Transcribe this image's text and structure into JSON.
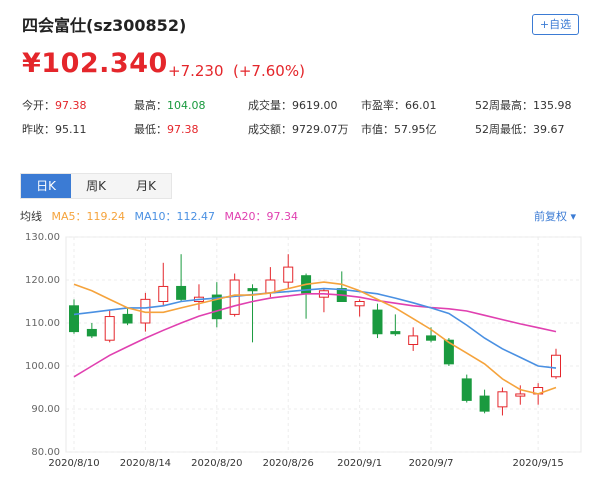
{
  "header": {
    "title": "四会富仕(sz300852)",
    "watch_button": "+自选"
  },
  "quote": {
    "price": "¥102.340",
    "change": "+7.230",
    "change_pct": "(+7.60%)"
  },
  "stats": {
    "open_label": "今开：",
    "open": "97.38",
    "high_label": "最高：",
    "high": "104.08",
    "volume_label": "成交量：",
    "volume": "9619.00",
    "pe_label": "市盈率：",
    "pe": "66.01",
    "w52high_label": "52周最高：",
    "w52high": "135.98",
    "prev_label": "昨收：",
    "prev": "95.11",
    "low_label": "最低：",
    "low": "97.38",
    "amount_label": "成交额：",
    "amount": "9729.07万",
    "mcap_label": "市值：",
    "mcap": "57.95亿",
    "w52low_label": "52周最低：",
    "w52low": "39.67"
  },
  "tabs": [
    "日K",
    "周K",
    "月K"
  ],
  "ma_legend": {
    "label": "均线",
    "ma5": "MA5：119.24",
    "ma10": "MA10：112.47",
    "ma20": "MA20：97.34",
    "adjust": "前复权 ▾"
  },
  "colors": {
    "up": "#e4262b",
    "down": "#1a9a3f",
    "ma5": "#f5a33c",
    "ma10": "#4a90e2",
    "ma20": "#e040b0",
    "accent": "#3b7bd4"
  },
  "chart_data": {
    "type": "candlestick",
    "ylim": [
      80,
      130
    ],
    "yticks": [
      "130.00",
      "120.00",
      "110.00",
      "100.00",
      "90.00",
      "80.00"
    ],
    "xticks": [
      "2020/8/10",
      "2020/8/14",
      "2020/8/20",
      "2020/8/26",
      "2020/9/1",
      "2020/9/7",
      "2020/9/15"
    ],
    "xtick_index": [
      0,
      4,
      8,
      12,
      16,
      20,
      26
    ],
    "candles": [
      {
        "o": 114,
        "h": 115.5,
        "l": 107.5,
        "c": 108
      },
      {
        "o": 108.5,
        "h": 110,
        "l": 106.5,
        "c": 107
      },
      {
        "o": 106,
        "h": 113,
        "l": 105.5,
        "c": 111.5
      },
      {
        "o": 112,
        "h": 113.5,
        "l": 109.5,
        "c": 110
      },
      {
        "o": 110,
        "h": 117,
        "l": 108,
        "c": 115.5
      },
      {
        "o": 115,
        "h": 124,
        "l": 114,
        "c": 118.5
      },
      {
        "o": 118.5,
        "h": 126,
        "l": 115,
        "c": 115.5
      },
      {
        "o": 115,
        "h": 119,
        "l": 113,
        "c": 116
      },
      {
        "o": 116.5,
        "h": 119.5,
        "l": 109,
        "c": 111
      },
      {
        "o": 112,
        "h": 121.5,
        "l": 111.5,
        "c": 120
      },
      {
        "o": 118,
        "h": 119,
        "l": 105.5,
        "c": 117.5
      },
      {
        "o": 117,
        "h": 123,
        "l": 116,
        "c": 120
      },
      {
        "o": 119.5,
        "h": 126,
        "l": 118,
        "c": 123
      },
      {
        "o": 121,
        "h": 121.5,
        "l": 111,
        "c": 117
      },
      {
        "o": 116,
        "h": 118,
        "l": 112.5,
        "c": 117.5
      },
      {
        "o": 118,
        "h": 122,
        "l": 116,
        "c": 115
      },
      {
        "o": 114,
        "h": 115.5,
        "l": 111.5,
        "c": 115
      },
      {
        "o": 113,
        "h": 114.5,
        "l": 106.5,
        "c": 107.5
      },
      {
        "o": 108,
        "h": 112,
        "l": 107,
        "c": 107.5
      },
      {
        "o": 105,
        "h": 109,
        "l": 103.5,
        "c": 107
      },
      {
        "o": 107,
        "h": 109,
        "l": 105.5,
        "c": 106
      },
      {
        "o": 106,
        "h": 106.5,
        "l": 100,
        "c": 100.5
      },
      {
        "o": 97,
        "h": 98,
        "l": 91.5,
        "c": 92
      },
      {
        "o": 93,
        "h": 94.5,
        "l": 89,
        "c": 89.5
      },
      {
        "o": 90.5,
        "h": 95,
        "l": 88.5,
        "c": 94
      },
      {
        "o": 93,
        "h": 95.5,
        "l": 91,
        "c": 93.5
      },
      {
        "o": 93.5,
        "h": 96,
        "l": 91,
        "c": 95
      },
      {
        "o": 97.5,
        "h": 104,
        "l": 97,
        "c": 102.5
      }
    ],
    "ma5": [
      119,
      117.5,
      115.5,
      113.5,
      112.5,
      112.5,
      113.5,
      114.5,
      115.5,
      116.5,
      116.5,
      117,
      118,
      119,
      119.5,
      119,
      117.5,
      115.5,
      113.5,
      111,
      108.5,
      105.5,
      103,
      100.5,
      97,
      94.5,
      93.5,
      95
    ],
    "ma10": [
      112,
      112.5,
      113,
      113.5,
      113.5,
      114,
      115,
      115.5,
      115.8,
      116.2,
      116.6,
      117,
      117.3,
      117.7,
      118,
      117.8,
      117.3,
      116.8,
      115.8,
      114.7,
      113.5,
      112.2,
      109.5,
      106.5,
      104,
      102,
      100,
      99.5
    ],
    "ma20": [
      97.5,
      100,
      102.5,
      104.5,
      106.5,
      108.3,
      110,
      111.6,
      112.8,
      114,
      115,
      115.8,
      116.3,
      116.8,
      116.8,
      116.5,
      116,
      115.2,
      114.6,
      114,
      113.6,
      113.3,
      112.8,
      111.8,
      110.8,
      109.8,
      108.9,
      108
    ]
  }
}
